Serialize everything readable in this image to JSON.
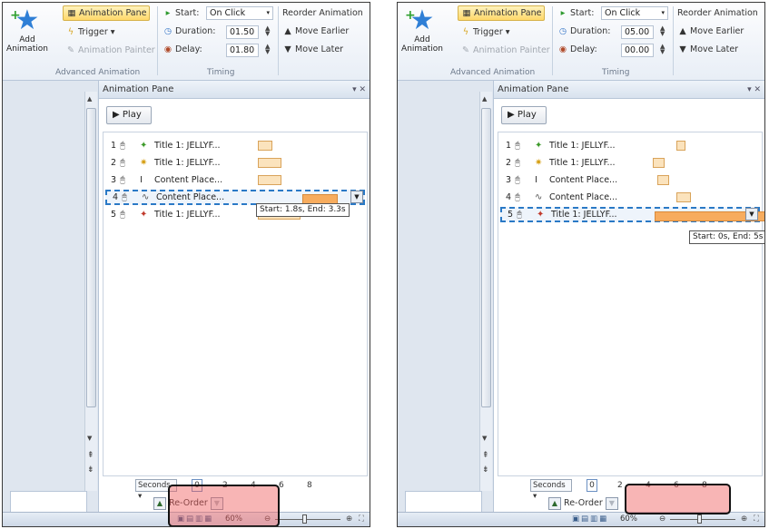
{
  "ribbon": {
    "add_animation": "Add\nAnimation",
    "animation_pane": "Animation Pane",
    "trigger": "Trigger",
    "animation_painter": "Animation Painter",
    "advanced_group": "Advanced Animation",
    "start_label": "Start:",
    "start_value": "On Click",
    "duration_label": "Duration:",
    "delay_label": "Delay:",
    "timing_group": "Timing",
    "reorder_title": "Reorder Animation",
    "move_earlier": "Move Earlier",
    "move_later": "Move Later"
  },
  "pane": {
    "title": "Animation Pane",
    "play": "Play",
    "seconds": "Seconds",
    "reorder": "Re-Order"
  },
  "panels": [
    {
      "duration_value": "01.50",
      "delay_value": "01.80",
      "selected_index": 3,
      "tooltip": "Start: 1.8s, End: 3.3s",
      "ticks": [
        "0",
        "2",
        "4",
        "6",
        "8"
      ],
      "zoom": "60%",
      "items": [
        {
          "num": "1",
          "name": "Title 1: JELLYF...",
          "effect_icon": "entrance-star-icon",
          "bar_start": 0.0,
          "bar_end": 0.6
        },
        {
          "num": "2",
          "name": "Title 1: JELLYF...",
          "effect_icon": "emphasis-star-icon",
          "bar_start": 0.0,
          "bar_end": 1.0
        },
        {
          "num": "3",
          "name": "Content Place...",
          "effect_icon": "text-cursor-icon",
          "bar_start": 0.0,
          "bar_end": 1.0
        },
        {
          "num": "4",
          "name": "Content Place...",
          "effect_icon": "motion-path-icon",
          "bar_start": 1.8,
          "bar_end": 3.3
        },
        {
          "num": "5",
          "name": "Title 1: JELLYF...",
          "effect_icon": "exit-star-icon",
          "bar_start": 0.0,
          "bar_end": 1.8
        }
      ]
    },
    {
      "duration_value": "05.00",
      "delay_value": "00.00",
      "selected_index": 4,
      "tooltip": "Start: 0s, End: 5s",
      "ticks": [
        "0",
        "2",
        "4",
        "6",
        "8"
      ],
      "zoom": "60%",
      "items": [
        {
          "num": "1",
          "name": "Title 1: JELLYF...",
          "effect_icon": "entrance-star-icon",
          "bar_start": 1.0,
          "bar_end": 1.4
        },
        {
          "num": "2",
          "name": "Title 1: JELLYF...",
          "effect_icon": "emphasis-star-icon",
          "bar_start": 0.0,
          "bar_end": 0.5
        },
        {
          "num": "3",
          "name": "Content Place...",
          "effect_icon": "text-cursor-icon",
          "bar_start": 0.2,
          "bar_end": 0.7
        },
        {
          "num": "4",
          "name": "Content Place...",
          "effect_icon": "motion-path-icon",
          "bar_start": 1.0,
          "bar_end": 1.6
        },
        {
          "num": "5",
          "name": "Title 1: JELLYF...",
          "effect_icon": "exit-star-icon",
          "bar_start": 0.0,
          "bar_end": 5.0
        }
      ]
    }
  ],
  "colors": {
    "highlight": "#f05a5a",
    "selection": "#2a79c6",
    "bar": "#fbe3bd",
    "bar_active": "#f7ac5e"
  }
}
